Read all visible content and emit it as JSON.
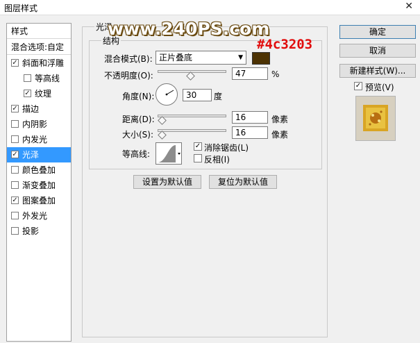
{
  "window": {
    "title": "图层样式",
    "close_glyph": "✕"
  },
  "left_list": {
    "header": "样式",
    "blend_options": "混合选项:自定",
    "items": [
      {
        "label": "斜面和浮雕",
        "checked": true,
        "indent": false
      },
      {
        "label": "等高线",
        "checked": false,
        "indent": true
      },
      {
        "label": "纹理",
        "checked": true,
        "indent": true
      },
      {
        "label": "描边",
        "checked": true,
        "indent": false
      },
      {
        "label": "内阴影",
        "checked": false,
        "indent": false
      },
      {
        "label": "内发光",
        "checked": false,
        "indent": false
      },
      {
        "label": "光泽",
        "checked": true,
        "indent": false,
        "selected": true
      },
      {
        "label": "颜色叠加",
        "checked": false,
        "indent": false
      },
      {
        "label": "渐变叠加",
        "checked": false,
        "indent": false
      },
      {
        "label": "图案叠加",
        "checked": true,
        "indent": false
      },
      {
        "label": "外发光",
        "checked": false,
        "indent": false
      },
      {
        "label": "投影",
        "checked": false,
        "indent": false
      }
    ],
    "check_glyph": "✓"
  },
  "panel": {
    "title": "光泽",
    "structure_title": "结构",
    "blend_mode_label": "混合模式(B):",
    "blend_mode_value": "正片叠底",
    "dropdown_arrow": "▼",
    "color_swatch": "#4c3203",
    "opacity_label": "不透明度(O):",
    "opacity_value": "47",
    "opacity_unit": "%",
    "opacity_fraction": 0.47,
    "angle_label": "角度(N):",
    "angle_value": "30",
    "angle_unit": "度",
    "distance_label": "距离(D):",
    "distance_value": "16",
    "distance_unit": "像素",
    "distance_fraction": 0.06,
    "size_label": "大小(S):",
    "size_value": "16",
    "size_unit": "像素",
    "size_fraction": 0.06,
    "contour_label": "等高线:",
    "antialias_label": "消除锯齿(L)",
    "antialias_checked": true,
    "invert_label": "反相(I)",
    "invert_checked": false,
    "make_default": "设置为默认值",
    "reset_default": "复位为默认值"
  },
  "watermark": {
    "url": "www.240PS.com",
    "hex": "#4c3203"
  },
  "right": {
    "ok": "确定",
    "cancel": "取消",
    "new_style": "新建样式(W)...",
    "preview_label": "预览(V)",
    "preview_checked": true
  }
}
